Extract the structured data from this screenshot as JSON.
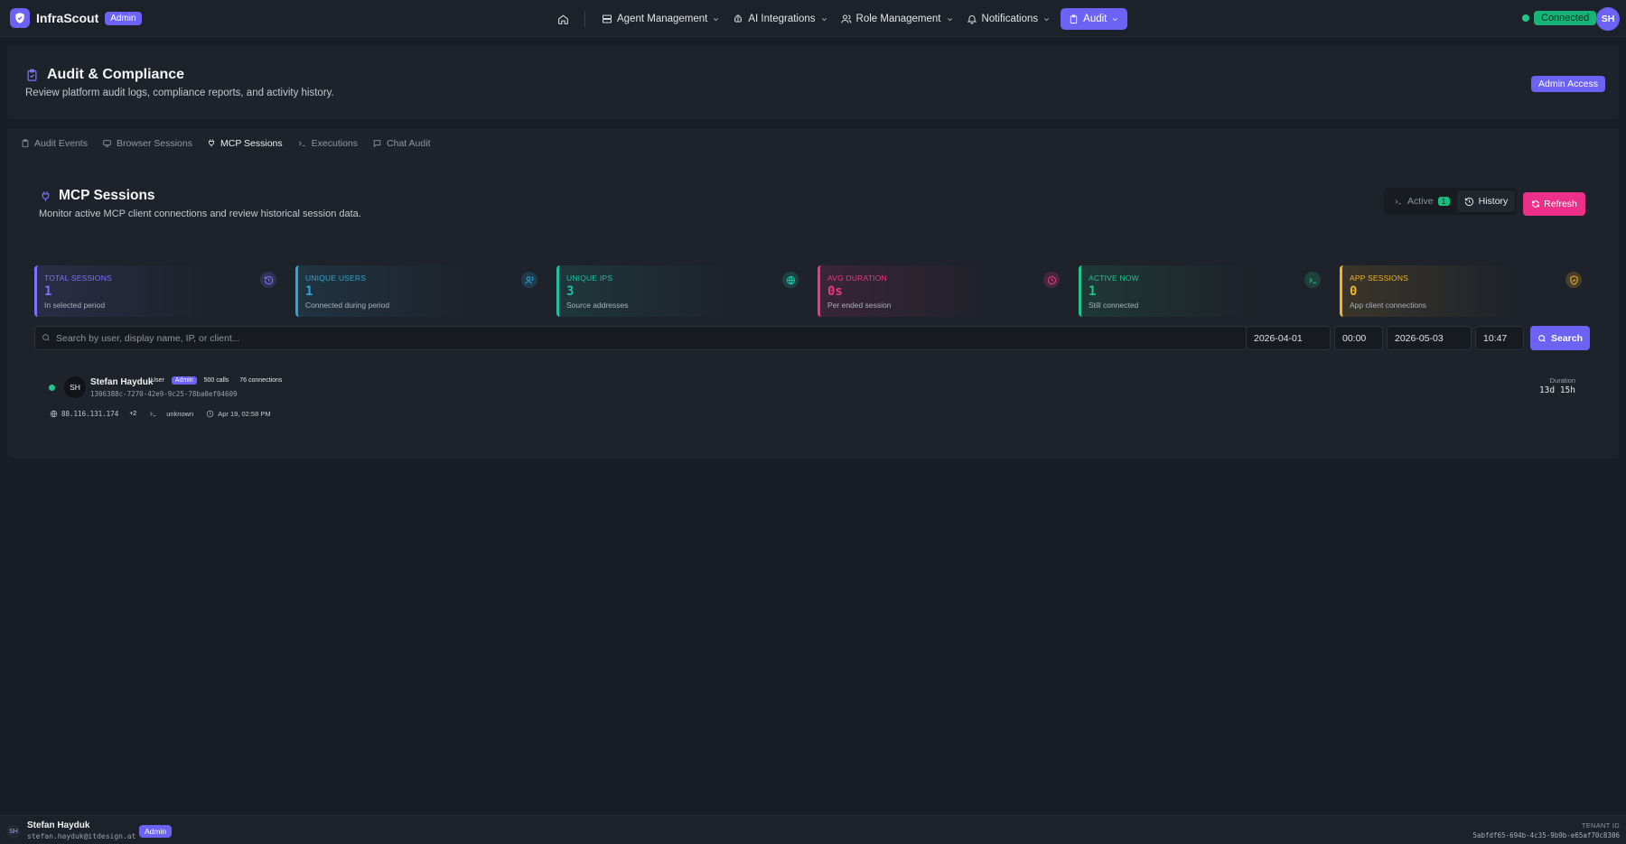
{
  "colors": {
    "accent": "#6c63f5",
    "success": "#22c58b",
    "refresh": "#ec2f88",
    "background": "#191d25",
    "card": "#1e222a"
  },
  "topbar": {
    "brand_name": "InfraScout",
    "brand_badge": "Admin",
    "nav": [
      {
        "label": "Agent Management",
        "icon": "server-icon"
      },
      {
        "label": "AI Integrations",
        "icon": "ai-brain-icon"
      },
      {
        "label": "Role Management",
        "icon": "users-icon"
      },
      {
        "label": "Notifications",
        "icon": "bell-icon"
      },
      {
        "label": "Audit",
        "icon": "clipboard-icon",
        "active": true
      }
    ],
    "connection_status": "Connected",
    "user_initials": "SH"
  },
  "page_header": {
    "title": "Audit & Compliance",
    "subtitle": "Review platform audit logs, compliance reports, and activity history.",
    "access_badge": "Admin Access"
  },
  "tabs": [
    {
      "label": "Audit Events",
      "icon": "clipboard-icon"
    },
    {
      "label": "Browser Sessions",
      "icon": "monitor-icon"
    },
    {
      "label": "MCP Sessions",
      "icon": "plug-icon",
      "active": true
    },
    {
      "label": "Executions",
      "icon": "terminal-icon"
    },
    {
      "label": "Chat Audit",
      "icon": "chat-icon"
    }
  ],
  "section": {
    "title": "MCP Sessions",
    "subtitle": "Monitor active MCP client connections and review historical session data.",
    "mode_active_label": "Active",
    "mode_active_count": "1",
    "mode_history_label": "History",
    "refresh_label": "Refresh"
  },
  "stats": [
    {
      "label": "TOTAL SESSIONS",
      "value": "1",
      "desc": "In selected period",
      "color": "#7b73ff",
      "icon": "history-icon"
    },
    {
      "label": "UNIQUE USERS",
      "value": "1",
      "desc": "Connected during period",
      "color": "#2aa7d6",
      "icon": "users-icon"
    },
    {
      "label": "UNIQUE IPS",
      "value": "3",
      "desc": "Source addresses",
      "color": "#1fbfa6",
      "icon": "globe-icon"
    },
    {
      "label": "AVG DURATION",
      "value": "0s",
      "desc": "Per ended session",
      "color": "#e83a83",
      "icon": "clock-icon"
    },
    {
      "label": "ACTIVE NOW",
      "value": "1",
      "desc": "Still connected",
      "color": "#22c58b",
      "icon": "terminal-icon"
    },
    {
      "label": "APP SESSIONS",
      "value": "0",
      "desc": "App client connections",
      "color": "#f0b429",
      "icon": "shield-icon"
    }
  ],
  "filters": {
    "search_placeholder": "Search by user, display name, IP, or client...",
    "from_date": "2026-04-01",
    "from_time": "00:00",
    "to_date": "2026-05-03",
    "to_time": "10:47",
    "search_label": "Search"
  },
  "sessions": [
    {
      "initials": "SH",
      "name": "Stefan Hayduk",
      "role_tag": "User",
      "admin_tag": "Admin",
      "calls": "500 calls",
      "connections": "76 connections",
      "id": "1306388c-7270-42e9-9c25-78ba0ef04609",
      "ip": "88.116.131.174",
      "ip_extra": "+2",
      "client": "unknown",
      "started": "Apr 19, 02:58 PM",
      "duration_label": "Duration",
      "duration": "13d 15h"
    }
  ],
  "footer": {
    "initials": "SH",
    "name": "Stefan Hayduk",
    "email": "stefan.hayduk@itdesign.at",
    "badge": "Admin",
    "tenant_label": "TENANT ID",
    "tenant_id": "5abfdf65-694b-4c35-9b9b-e65af70c8306"
  }
}
